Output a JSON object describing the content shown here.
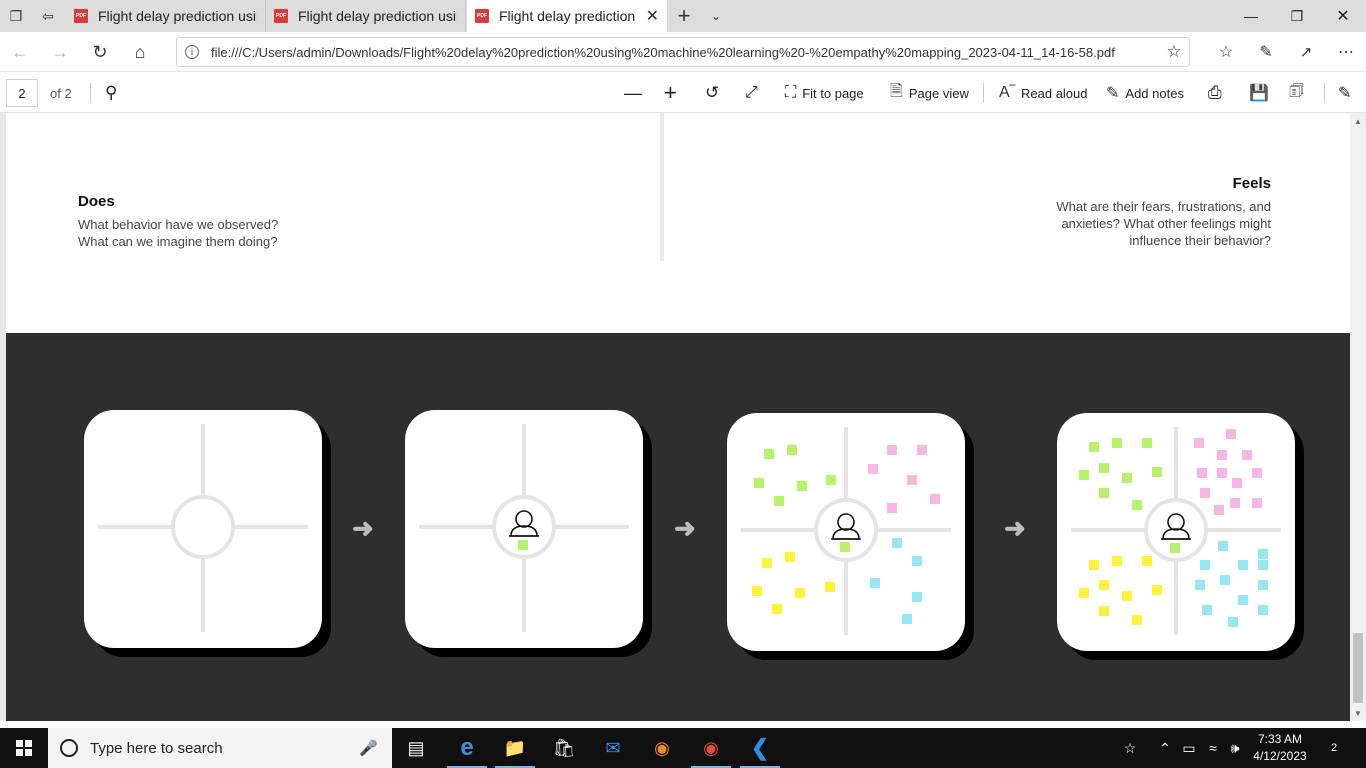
{
  "browser": {
    "tabs": [
      {
        "label": "Flight delay prediction using",
        "active": false
      },
      {
        "label": "Flight delay prediction using",
        "active": false
      },
      {
        "label": "Flight delay prediction u",
        "active": true
      }
    ],
    "url": "file:///C:/Users/admin/Downloads/Flight%20delay%20prediction%20using%20machine%20learning%20-%20empathy%20mapping_2023-04-11_14-16-58.pdf"
  },
  "pdf_toolbar": {
    "page_number": "2",
    "page_count": "of 2",
    "fit_to_page": "Fit to page",
    "page_view": "Page view",
    "read_aloud": "Read aloud",
    "add_notes": "Add notes"
  },
  "document": {
    "does": {
      "title": "Does",
      "line1": "What behavior have we observed?",
      "line2": "What can we imagine them doing?"
    },
    "feels": {
      "title": "Feels",
      "line1": "What are their fears, frustrations, and",
      "line2": "anxieties? What other feelings might",
      "line3": "influence their behavior?"
    },
    "steps": [
      {
        "id": "step-1-empty-grid",
        "has_persona": false,
        "notes": []
      },
      {
        "id": "step-2-persona",
        "has_persona": true,
        "notes": [
          {
            "c": "green",
            "x": 0,
            "y": 20
          }
        ]
      },
      {
        "id": "step-3-few-notes",
        "has_persona": true,
        "notes": "few"
      },
      {
        "id": "step-4-many-notes",
        "has_persona": true,
        "notes": "many"
      }
    ],
    "note_colors": {
      "green": "#b6f26a",
      "pink": "#f7b6e4",
      "yellow": "#fff23a",
      "blue": "#97e6f6"
    }
  },
  "taskbar": {
    "search_placeholder": "Type here to search",
    "time": "7:33 AM",
    "date": "4/12/2023",
    "notifications": "2"
  }
}
